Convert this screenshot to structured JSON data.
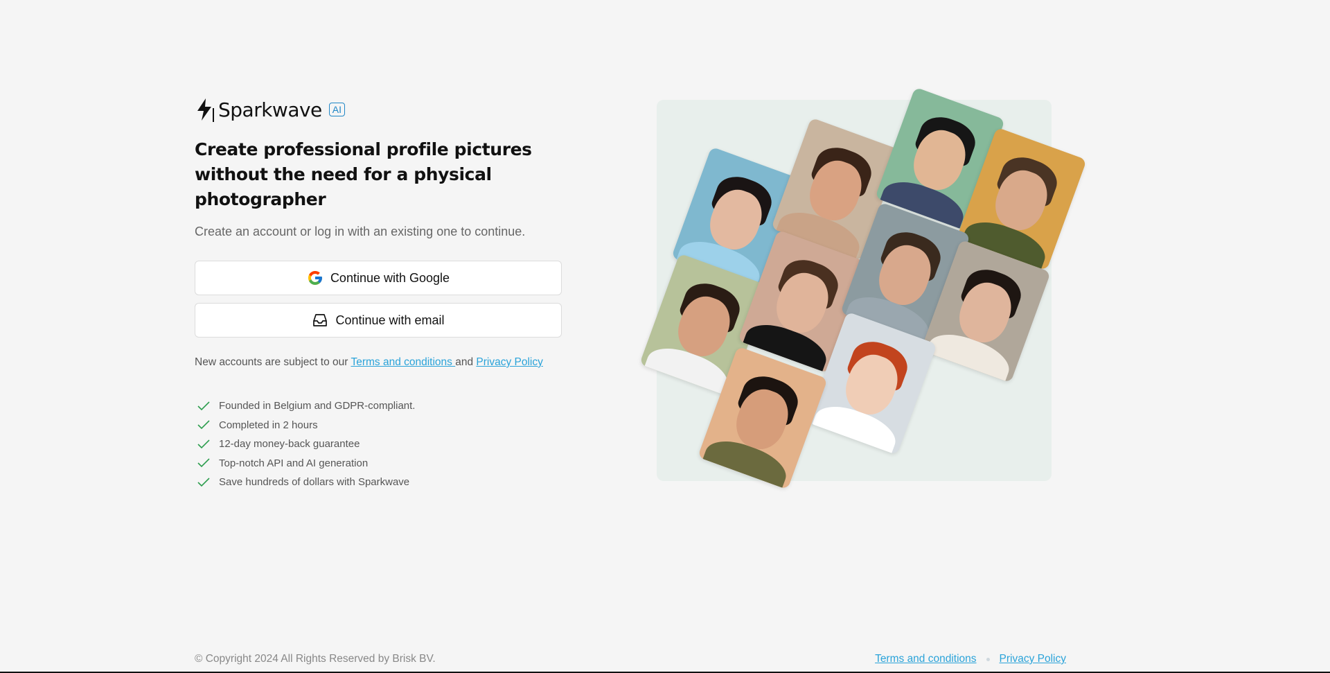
{
  "brand": {
    "name": "Sparkwave",
    "badge": "AI"
  },
  "headline": "Create professional profile pictures without the need for a physical photographer",
  "subheading": "Create an account or log in with an existing one to continue.",
  "buttons": {
    "google": "Continue with Google",
    "email": "Continue with email"
  },
  "terms": {
    "prefix": "New accounts are subject to our ",
    "terms_link": "Terms and conditions ",
    "and": "and ",
    "privacy_link": "Privacy Policy"
  },
  "features": [
    "Founded in Belgium and GDPR-compliant.",
    "Completed in 2 hours",
    "12-day money-back guarantee",
    "Top-notch API and AI generation",
    "Save hundreds of dollars with Sparkwave"
  ],
  "footer": {
    "copyright": "© Copyright 2024 All Rights Reserved by Brisk BV.",
    "terms_link": "Terms and conditions",
    "privacy_link": "Privacy Policy"
  },
  "colors": {
    "link": "#2aa3d9",
    "check": "#2e9e4f",
    "badge": "#1f86c6",
    "panel_bg": "#e8efec"
  },
  "icons": {
    "brand": "bolt-icon",
    "google": "google-icon",
    "email": "inbox-icon",
    "feature": "check-icon"
  }
}
